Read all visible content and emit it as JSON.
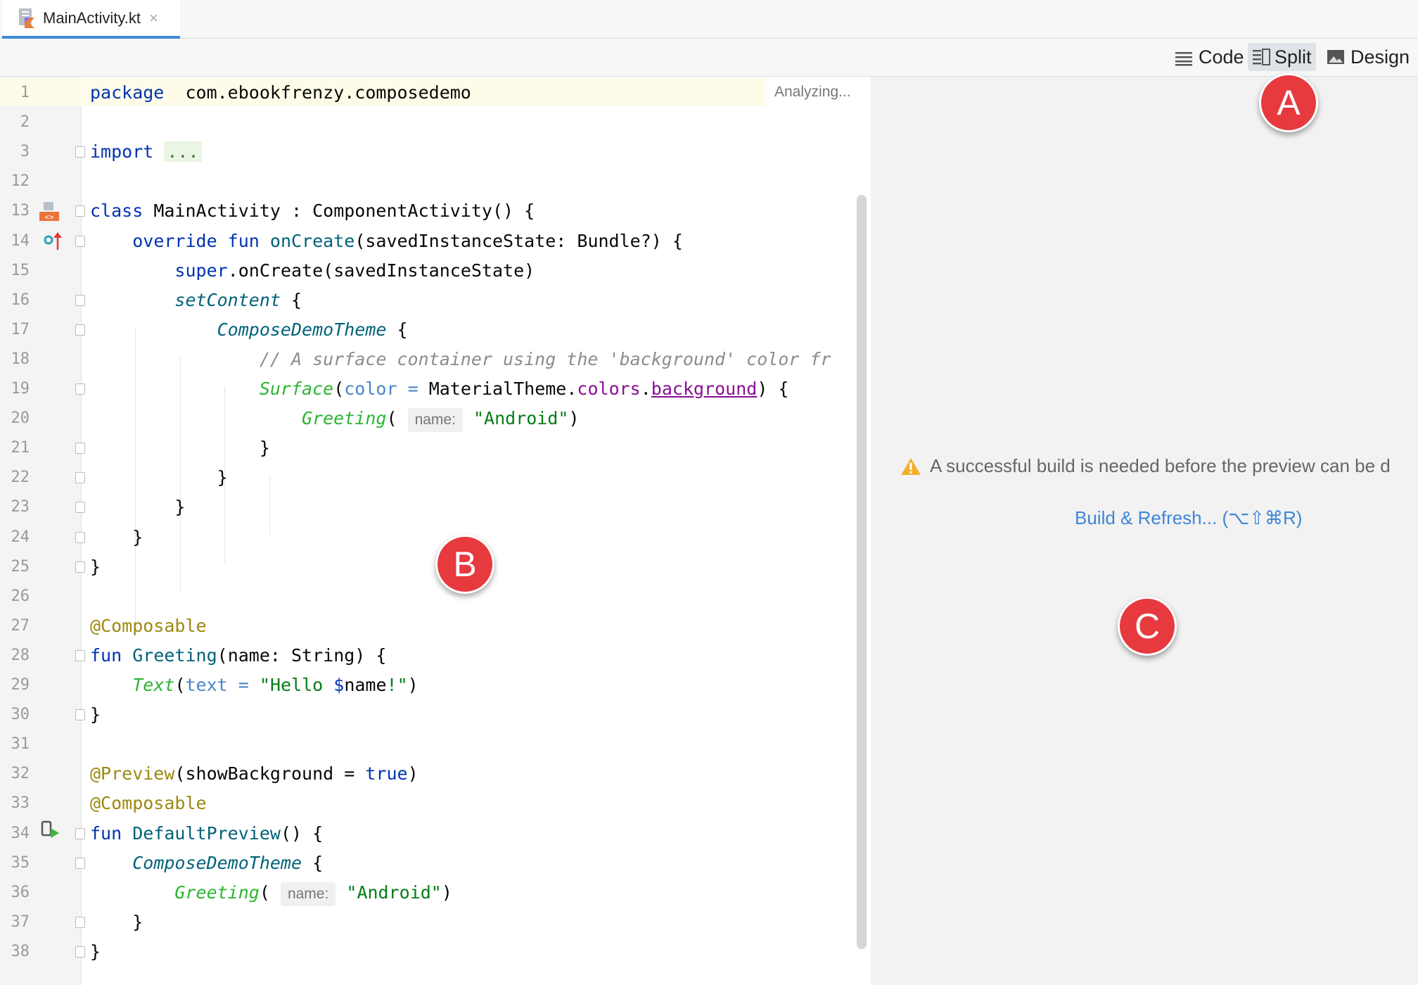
{
  "tab": {
    "filename": "MainActivity.kt",
    "close": "×"
  },
  "toolbar": {
    "code": "Code",
    "split": "Split",
    "design": "Design"
  },
  "editor": {
    "status": "Analyzing...",
    "lines": [
      {
        "n": "1",
        "segs": [
          [
            "kw",
            "package"
          ],
          [
            "",
            "  com.ebookfrenzy.composedemo"
          ]
        ]
      },
      {
        "n": "2",
        "segs": []
      },
      {
        "n": "3",
        "segs": [
          [
            "kw",
            "import"
          ],
          [
            "",
            " "
          ],
          [
            "imp",
            "..."
          ]
        ]
      },
      {
        "n": "12",
        "segs": []
      },
      {
        "n": "13",
        "segs": [
          [
            "kw",
            "class"
          ],
          [
            "",
            " MainActivity : ComponentActivity() {"
          ]
        ]
      },
      {
        "n": "14",
        "segs": [
          [
            "",
            "    "
          ],
          [
            "kw",
            "override fun"
          ],
          [
            "",
            " "
          ],
          [
            "fn",
            "onCreate"
          ],
          [
            "",
            "(savedInstanceState: Bundle?) {"
          ]
        ]
      },
      {
        "n": "15",
        "segs": [
          [
            "",
            "        "
          ],
          [
            "kw",
            "super"
          ],
          [
            "",
            ".onCreate(savedInstanceState)"
          ]
        ]
      },
      {
        "n": "16",
        "segs": [
          [
            "",
            "        "
          ],
          [
            "it",
            "setContent"
          ],
          [
            "",
            " {"
          ]
        ]
      },
      {
        "n": "17",
        "segs": [
          [
            "",
            "            "
          ],
          [
            "it",
            "ComposeDemoTheme"
          ],
          [
            "",
            " {"
          ]
        ]
      },
      {
        "n": "18",
        "segs": [
          [
            "",
            "                "
          ],
          [
            "cm",
            "// A surface container using the 'background' color fr"
          ]
        ]
      },
      {
        "n": "19",
        "segs": [
          [
            "",
            "                "
          ],
          [
            "grn",
            "Surface"
          ],
          [
            "",
            "("
          ],
          [
            "prm",
            "color"
          ],
          [
            "",
            " "
          ],
          [
            "prm",
            "="
          ],
          [
            "",
            " MaterialTheme."
          ],
          [
            "pur",
            "colors"
          ],
          [
            "",
            "."
          ],
          [
            "purul",
            "background"
          ],
          [
            "",
            ") {"
          ]
        ]
      },
      {
        "n": "20",
        "segs": [
          [
            "",
            "                    "
          ],
          [
            "grn",
            "Greeting"
          ],
          [
            "",
            "( "
          ],
          [
            "hint",
            "name:"
          ],
          [
            "",
            " "
          ],
          [
            "str",
            "\"Android\""
          ],
          [
            "",
            ")"
          ]
        ]
      },
      {
        "n": "21",
        "segs": [
          [
            "",
            "                }"
          ]
        ]
      },
      {
        "n": "22",
        "segs": [
          [
            "",
            "            }"
          ]
        ]
      },
      {
        "n": "23",
        "segs": [
          [
            "",
            "        }"
          ]
        ]
      },
      {
        "n": "24",
        "segs": [
          [
            "",
            "    }"
          ]
        ]
      },
      {
        "n": "25",
        "segs": [
          [
            "",
            "}"
          ]
        ]
      },
      {
        "n": "26",
        "segs": []
      },
      {
        "n": "27",
        "segs": [
          [
            "an",
            "@Composable"
          ]
        ]
      },
      {
        "n": "28",
        "segs": [
          [
            "kw",
            "fun"
          ],
          [
            "",
            " "
          ],
          [
            "fn",
            "Greeting"
          ],
          [
            "",
            "(name: String) {"
          ]
        ]
      },
      {
        "n": "29",
        "segs": [
          [
            "",
            "    "
          ],
          [
            "grn",
            "Text"
          ],
          [
            "",
            "("
          ],
          [
            "prm",
            "text"
          ],
          [
            "",
            " "
          ],
          [
            "prm",
            "="
          ],
          [
            "",
            " "
          ],
          [
            "str",
            "\"Hello "
          ],
          [
            "kw",
            "$"
          ],
          [
            "",
            "name"
          ],
          [
            "str",
            "!\""
          ],
          [
            "",
            ")"
          ]
        ]
      },
      {
        "n": "30",
        "segs": [
          [
            "",
            "}"
          ]
        ]
      },
      {
        "n": "31",
        "segs": []
      },
      {
        "n": "32",
        "segs": [
          [
            "an",
            "@Preview"
          ],
          [
            "",
            "(showBackground = "
          ],
          [
            "kw",
            "true"
          ],
          [
            "",
            ")"
          ]
        ]
      },
      {
        "n": "33",
        "segs": [
          [
            "an",
            "@Composable"
          ]
        ]
      },
      {
        "n": "34",
        "segs": [
          [
            "kw",
            "fun"
          ],
          [
            "",
            " "
          ],
          [
            "fn",
            "DefaultPreview"
          ],
          [
            "",
            "() {"
          ]
        ]
      },
      {
        "n": "35",
        "segs": [
          [
            "",
            "    "
          ],
          [
            "it",
            "ComposeDemoTheme"
          ],
          [
            "",
            " {"
          ]
        ]
      },
      {
        "n": "36",
        "segs": [
          [
            "",
            "        "
          ],
          [
            "grn",
            "Greeting"
          ],
          [
            "",
            "( "
          ],
          [
            "hint",
            "name:"
          ],
          [
            "",
            " "
          ],
          [
            "str",
            "\"Android\""
          ],
          [
            "",
            ")"
          ]
        ]
      },
      {
        "n": "37",
        "segs": [
          [
            "",
            "    }"
          ]
        ]
      },
      {
        "n": "38",
        "segs": [
          [
            "",
            "}"
          ]
        ]
      }
    ]
  },
  "preview": {
    "message": "A successful build is needed before the preview can be d",
    "link": "Build & Refresh... (⌥⇧⌘R)"
  },
  "callouts": {
    "a": "A",
    "b": "B",
    "c": "C"
  },
  "colors": {
    "accent": "#3d87d8",
    "callout": "#e63a3f",
    "link": "#3d87d8"
  }
}
